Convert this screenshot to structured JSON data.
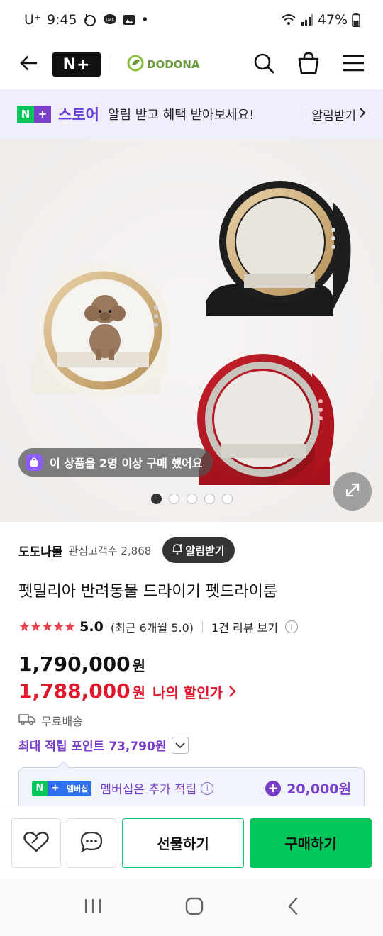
{
  "status_bar": {
    "carrier": "U⁺",
    "time": "9:45",
    "notification_icons": [
      "b-app-icon",
      "talk-icon",
      "gallery-icon"
    ],
    "dot": "•",
    "battery": "47%"
  },
  "header": {
    "logo_text": "N+",
    "brand": "DODONA"
  },
  "banner": {
    "store_label": "스토어",
    "message": "알림 받고 혜택 받아보세요!",
    "link_label": "알림받기"
  },
  "product_image": {
    "buy_badge": "이 상품을 2명 이상 구매 했어요",
    "page_count": 5,
    "active_page": 1
  },
  "product": {
    "seller": "도도나몰",
    "interest_label": "관심고객수",
    "interest_count": "2,868",
    "alert_button": "알림받기",
    "title": "펫밀리아 반려동물 드라이기 펫드라이룸",
    "rating": "5.0",
    "stars": "★★★★★",
    "rating_recent": "(최근 6개월 5.0)",
    "review_link": "1건 리뷰 보기",
    "price_original": "1,790,000",
    "currency": "원",
    "price_discount": "1,788,000",
    "discount_label": "나의 할인가",
    "shipping": "무료배송",
    "max_points": "최대 적립 포인트 73,790원",
    "membership_badge": "멤버십",
    "membership_msg": "멤버십은 추가 적립",
    "membership_points": "20,000원"
  },
  "actions": {
    "gift": "선물하기",
    "buy": "구매하기"
  },
  "colors": {
    "accent_green": "#03c75a",
    "purple": "#7a3fc9",
    "sale_red": "#e0162b"
  }
}
